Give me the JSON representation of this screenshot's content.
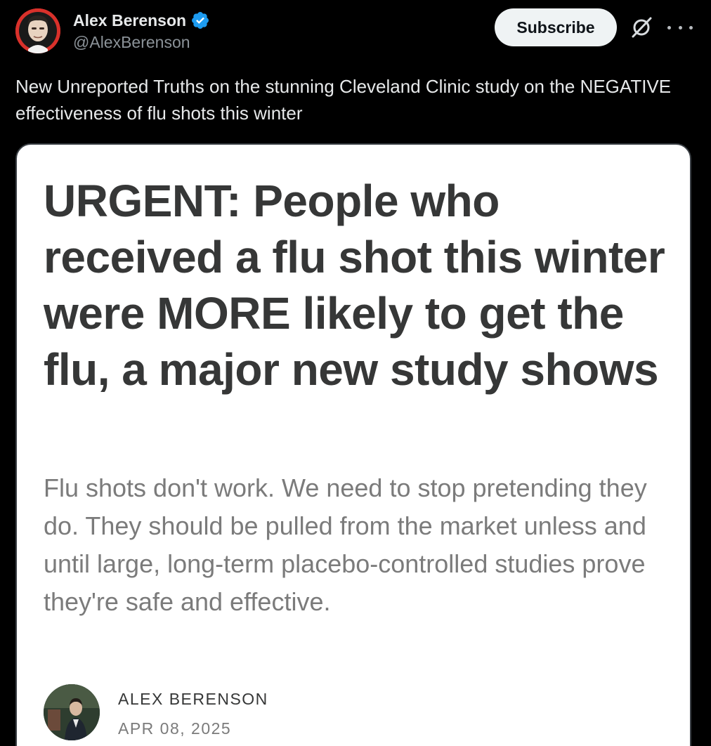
{
  "author": {
    "display_name": "Alex Berenson",
    "handle": "@AlexBerenson",
    "verified": true,
    "verified_icon": "verified-badge-icon",
    "verified_color": "#1d9bf0"
  },
  "actions": {
    "subscribe_label": "Subscribe",
    "grok_icon": "grok-icon",
    "more_icon": "more-options-icon"
  },
  "tweet": {
    "text": "New Unreported Truths on the stunning Cleveland Clinic study on the NEGATIVE effectiveness of flu shots this winter"
  },
  "card": {
    "title": "URGENT: People who received a flu shot this winter were MORE likely to get the flu, a major new study shows",
    "subtitle": "Flu shots don't work. We need to stop pretending they do. They should be pulled from the market unless and until large, long-term placebo-controlled studies prove they're safe and effective.",
    "author_name": "ALEX BERENSON",
    "date": "APR 08, 2025"
  },
  "colors": {
    "background": "#000000",
    "card_background": "#ffffff",
    "title_text": "#363737",
    "subtitle_text": "#7b7b7b",
    "subscribe_bg": "#eff3f4"
  }
}
